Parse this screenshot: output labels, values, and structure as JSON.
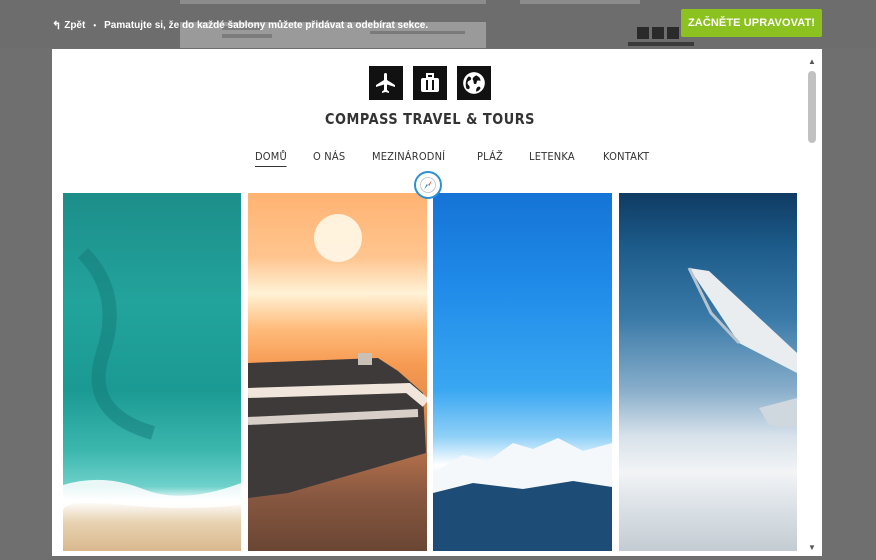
{
  "topbar": {
    "back_label": "Zpět",
    "separator": "•",
    "hint": "Pamatujte si, že do každé šablony můžete přidávat a odebírat sekce.",
    "cta_label": "ZAČNĚTE UPRAVOVAT!"
  },
  "site": {
    "brand": "COMPASS TRAVEL & TOURS",
    "logo_icons": [
      "airplane-icon",
      "suitcase-icon",
      "globe-icon"
    ],
    "nav": [
      {
        "label": "DOMŮ",
        "active": true
      },
      {
        "label": "O NÁS",
        "active": false
      },
      {
        "label": "MEZINÁRODNÍ",
        "active": false
      },
      {
        "label": "PLÁŽ",
        "active": false
      },
      {
        "label": "LETENKA",
        "active": false
      },
      {
        "label": "KONTAKT",
        "active": false
      }
    ],
    "tiles": [
      "beach-aerial-image",
      "cruise-ship-sunset-image",
      "snowy-mountains-sky-image",
      "airplane-wing-clouds-image"
    ]
  },
  "colors": {
    "cta": "#8cc21f",
    "compass_ring": "#2e8fd6",
    "backdrop": "#6f6f6f"
  }
}
